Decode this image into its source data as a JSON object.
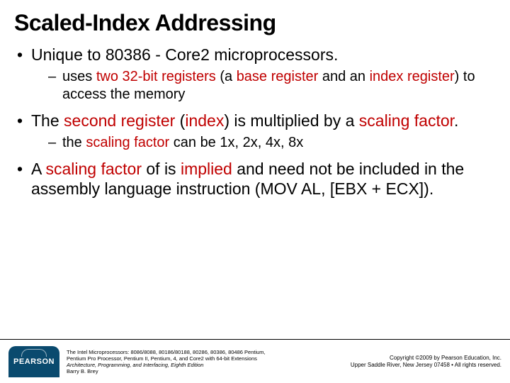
{
  "title": "Scaled-Index Addressing",
  "bullets": {
    "b1": {
      "pre": "Unique to 80386 - Core2 microprocessors.",
      "sub1": {
        "t1": "uses ",
        "r1": "two 32-bit registers",
        "t2": " (a ",
        "r2": "base register",
        "t3": " and an ",
        "r3": "index register",
        "t4": ") to access the memory"
      }
    },
    "b2": {
      "t1": "The ",
      "r1": "second register",
      "t2": " (",
      "r2": "index",
      "t3": ") is multiplied by a ",
      "r3": "scaling factor",
      "t4": ".",
      "sub1": {
        "t1": "the ",
        "r1": "scaling factor",
        "t2": " can be 1x, 2x, 4x, 8x"
      }
    },
    "b3": {
      "t1": "A ",
      "r1": "scaling factor",
      "t2": " of  is ",
      "r2": "implied",
      "t3": " and need not be included in the assembly language instruction (MOV AL, [EBX + ECX])."
    }
  },
  "footer": {
    "logo": "PEARSON",
    "book_line1": "The Intel Microprocessors: 8086/8088, 80186/80188, 80286, 80386, 80486 Pentium,",
    "book_line2": "Pentium Pro Processor, Pentium II, Pentium, 4, and Core2 with 64-bit Extensions",
    "book_line3": "Architecture, Programming, and Interfacing, Eighth Edition",
    "book_line4": "Barry B. Brey",
    "copy_line1": "Copyright ©2009 by Pearson Education, Inc.",
    "copy_line2": "Upper Saddle River, New Jersey 07458 • All rights reserved."
  }
}
